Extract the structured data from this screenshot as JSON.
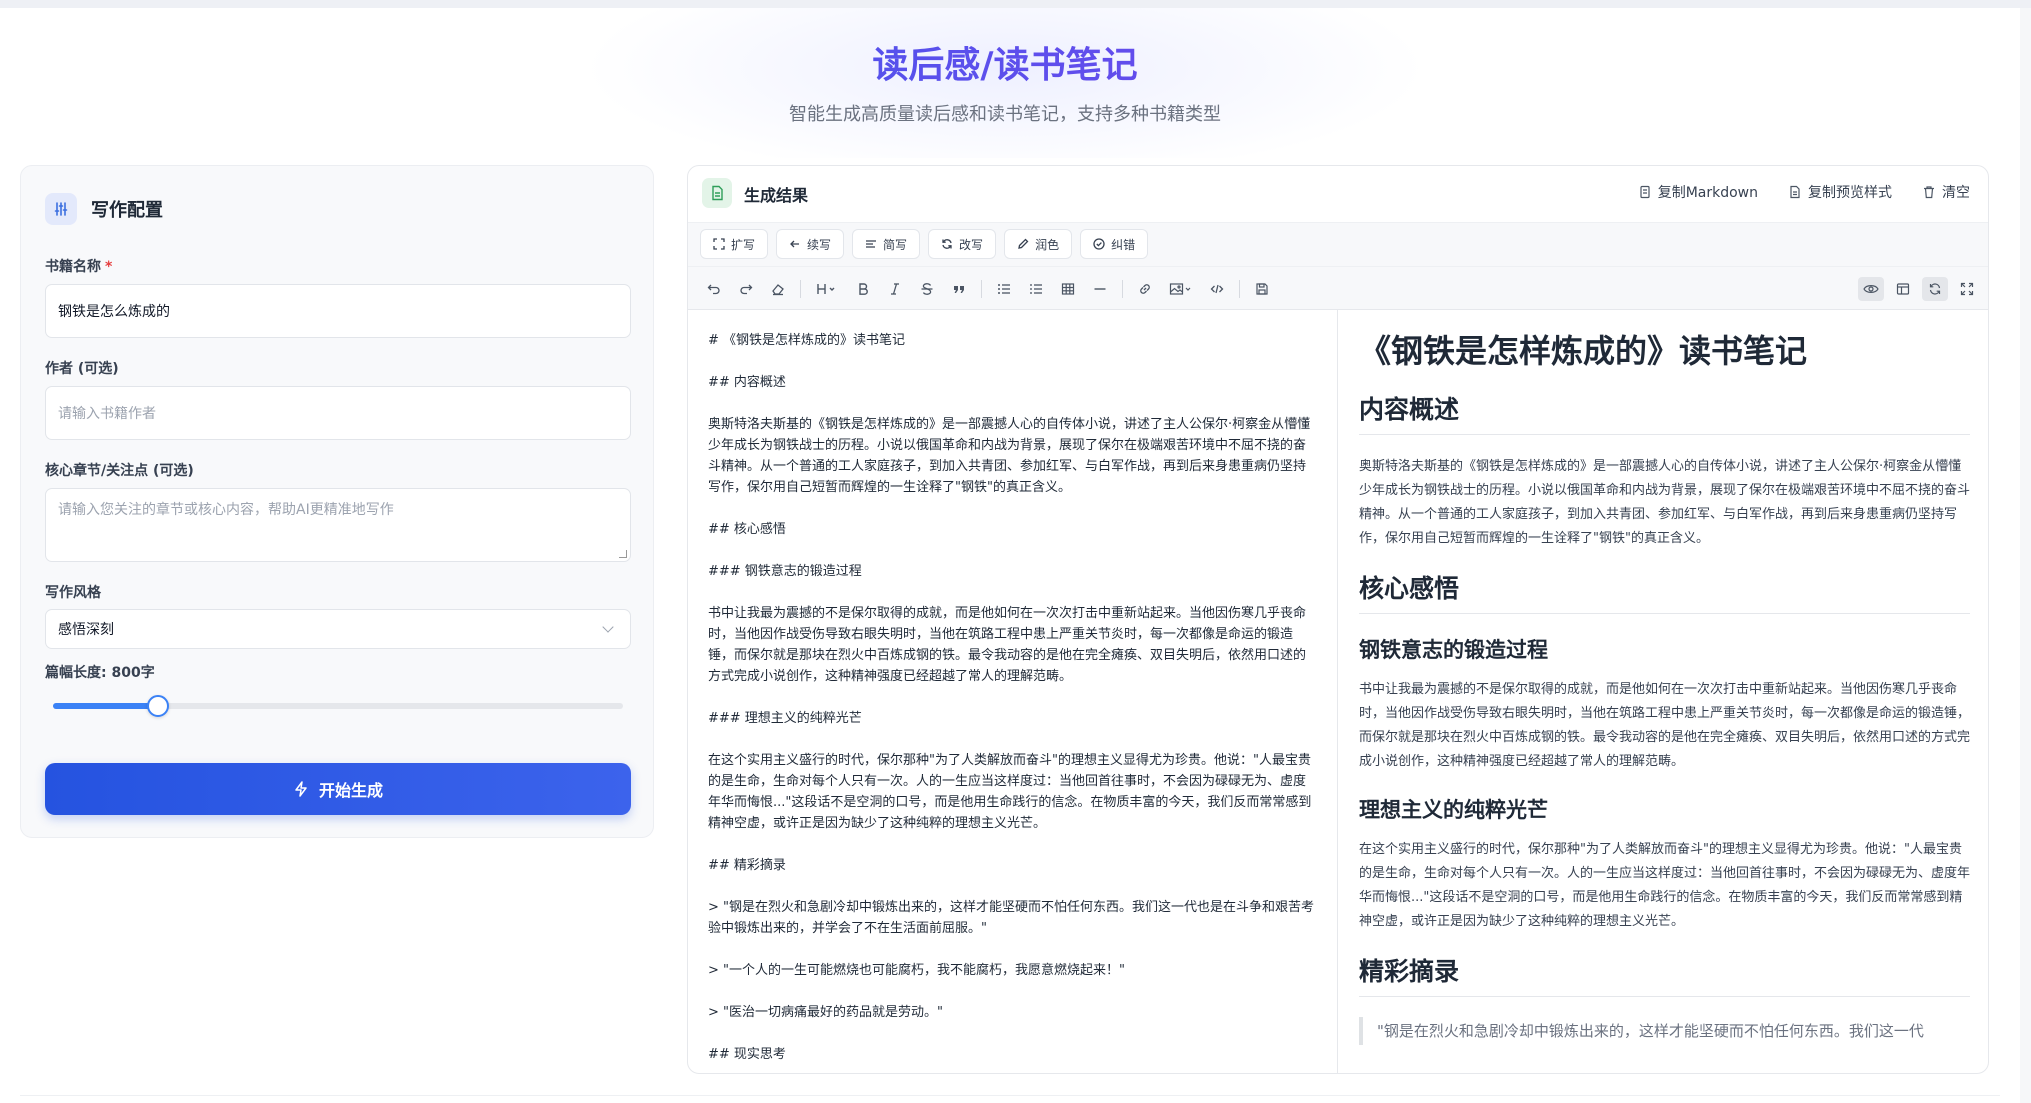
{
  "hero": {
    "title": "读后感/读书笔记",
    "subtitle": "智能生成高质量读后感和读书笔记，支持多种书籍类型"
  },
  "config": {
    "title": "写作配置",
    "book_name_label": "书籍名称",
    "required_mark": "*",
    "book_name_value": "钢铁是怎么炼成的",
    "author_label": "作者 (可选)",
    "author_placeholder": "请输入书籍作者",
    "focus_label": "核心章节/关注点 (可选)",
    "focus_placeholder": "请输入您关注的章节或核心内容，帮助AI更精准地写作",
    "style_label": "写作风格",
    "style_value": "感悟深刻",
    "length_label": "篇幅长度: 800字",
    "length_fraction": 0.185,
    "generate_label": "开始生成"
  },
  "result": {
    "title": "生成结果",
    "actions": [
      "复制Markdown",
      "复制预览样式",
      "清空"
    ],
    "ai_buttons": [
      "扩写",
      "续写",
      "简写",
      "改写",
      "润色",
      "纠错"
    ]
  },
  "editor": {
    "lines": [
      "# 《钢铁是怎样炼成的》读书笔记",
      "",
      "## 内容概述",
      "",
      "奥斯特洛夫斯基的《钢铁是怎样炼成的》是一部震撼人心的自传体小说，讲述了主人公保尔·柯察金从懵懂少年成长为钢铁战士的历程。小说以俄国革命和内战为背景，展现了保尔在极端艰苦环境中不屈不挠的奋斗精神。从一个普通的工人家庭孩子，到加入共青团、参加红军、与白军作战，再到后来身患重病仍坚持写作，保尔用自己短暂而辉煌的一生诠释了\"钢铁\"的真正含义。",
      "",
      "## 核心感悟",
      "",
      "### 钢铁意志的锻造过程",
      "",
      "书中让我最为震撼的不是保尔取得的成就，而是他如何在一次次打击中重新站起来。当他因伤寒几乎丧命时，当他因作战受伤导致右眼失明时，当他在筑路工程中患上严重关节炎时，每一次都像是命运的锻造锤，而保尔就是那块在烈火中百炼成钢的铁。最令我动容的是他在完全瘫痪、双目失明后，依然用口述的方式完成小说创作，这种精神强度已经超越了常人的理解范畴。",
      "",
      "### 理想主义的纯粹光芒",
      "",
      "在这个实用主义盛行的时代，保尔那种\"为了人类解放而奋斗\"的理想主义显得尤为珍贵。他说：\"人最宝贵的是生命，生命对每个人只有一次。人的一生应当这样度过：当他回首往事时，不会因为碌碌无为、虚度年华而悔恨...\"这段话不是空洞的口号，而是他用生命践行的信念。在物质丰富的今天，我们反而常常感到精神空虚，或许正是因为缺少了这种纯粹的理想主义光芒。",
      "",
      "## 精彩摘录",
      "",
      "> \"钢是在烈火和急剧冷却中锻炼出来的，这样才能坚硬而不怕任何东西。我们这一代也是在斗争和艰苦考验中锻炼出来的，并学会了不在生活面前屈服。\"",
      "",
      "> \"一个人的一生可能燃烧也可能腐朽，我不能腐朽，我愿意燃烧起来！\"",
      "",
      "> \"医治一切病痛最好的药品就是劳动。\"",
      "",
      "## 现实思考"
    ]
  },
  "preview": {
    "h1": "《钢铁是怎样炼成的》读书笔记",
    "h2_overview": "内容概述",
    "p_overview": "奥斯特洛夫斯基的《钢铁是怎样炼成的》是一部震撼人心的自传体小说，讲述了主人公保尔·柯察金从懵懂少年成长为钢铁战士的历程。小说以俄国革命和内战为背景，展现了保尔在极端艰苦环境中不屈不挠的奋斗精神。从一个普通的工人家庭孩子，到加入共青团、参加红军、与白军作战，再到后来身患重病仍坚持写作，保尔用自己短暂而辉煌的一生诠释了\"钢铁\"的真正含义。",
    "h2_core": "核心感悟",
    "h3_will": "钢铁意志的锻造过程",
    "p_will": "书中让我最为震撼的不是保尔取得的成就，而是他如何在一次次打击中重新站起来。当他因伤寒几乎丧命时，当他因作战受伤导致右眼失明时，当他在筑路工程中患上严重关节炎时，每一次都像是命运的锻造锤，而保尔就是那块在烈火中百炼成钢的铁。最令我动容的是他在完全瘫痪、双目失明后，依然用口述的方式完成小说创作，这种精神强度已经超越了常人的理解范畴。",
    "h3_ideal": "理想主义的纯粹光芒",
    "p_ideal": "在这个实用主义盛行的时代，保尔那种\"为了人类解放而奋斗\"的理想主义显得尤为珍贵。他说：\"人最宝贵的是生命，生命对每个人只有一次。人的一生应当这样度过：当他回首往事时，不会因为碌碌无为、虚度年华而悔恨...\"这段话不是空洞的口号，而是他用生命践行的信念。在物质丰富的今天，我们反而常常感到精神空虚，或许正是因为缺少了这种纯粹的理想主义光芒。",
    "h2_quotes": "精彩摘录",
    "quote1": "\"钢是在烈火和急剧冷却中锻炼出来的，这样才能坚硬而不怕任何东西。我们这一代"
  },
  "colors": {
    "accent": "#2553e0",
    "title_gradient_start": "#2f5fe8",
    "title_gradient_end": "#8a3ff0",
    "required": "#e53e3e"
  }
}
